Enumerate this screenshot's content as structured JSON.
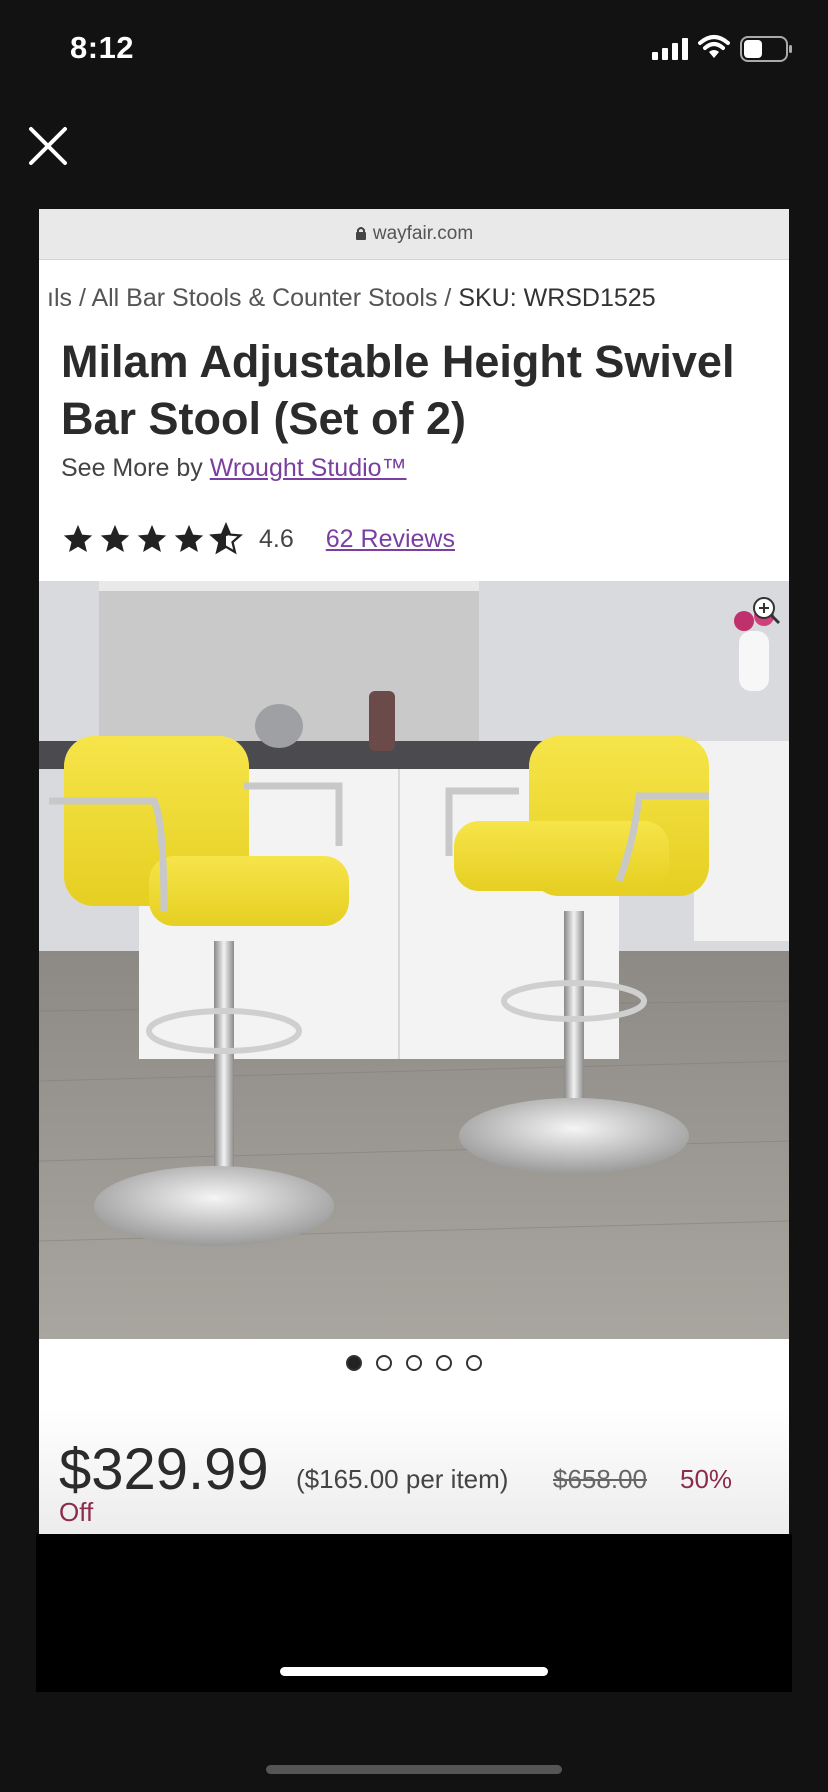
{
  "status_bar": {
    "time": "8:12",
    "icons": [
      "signal-icon",
      "wifi-icon",
      "battery-icon"
    ]
  },
  "viewer": {
    "close_icon": "close-icon"
  },
  "browser": {
    "url": "wayfair.com"
  },
  "product": {
    "breadcrumbs": "ıls / All Bar Stools & Counter Stools /",
    "sku": "SKU: WRSD1525",
    "title": "Milam Adjustable Height Swivel Bar Stool (Set of 2)",
    "see_more_prefix": "See More by ",
    "brand": "Wrought Studio™",
    "rating_value": "4.6",
    "rating_stars": 4.6,
    "reviews": "62 Reviews",
    "image_pager": {
      "count": 5,
      "active": 0
    },
    "price": "$329.99",
    "per_item": "($165.00 per item)",
    "was_price": "$658.00",
    "discount_part1": "50%",
    "discount_part2": "Off"
  },
  "colors": {
    "accent_purple": "#7a3fa0",
    "discount": "#8c2c4c",
    "stool_yellow": "#f3e03a"
  }
}
